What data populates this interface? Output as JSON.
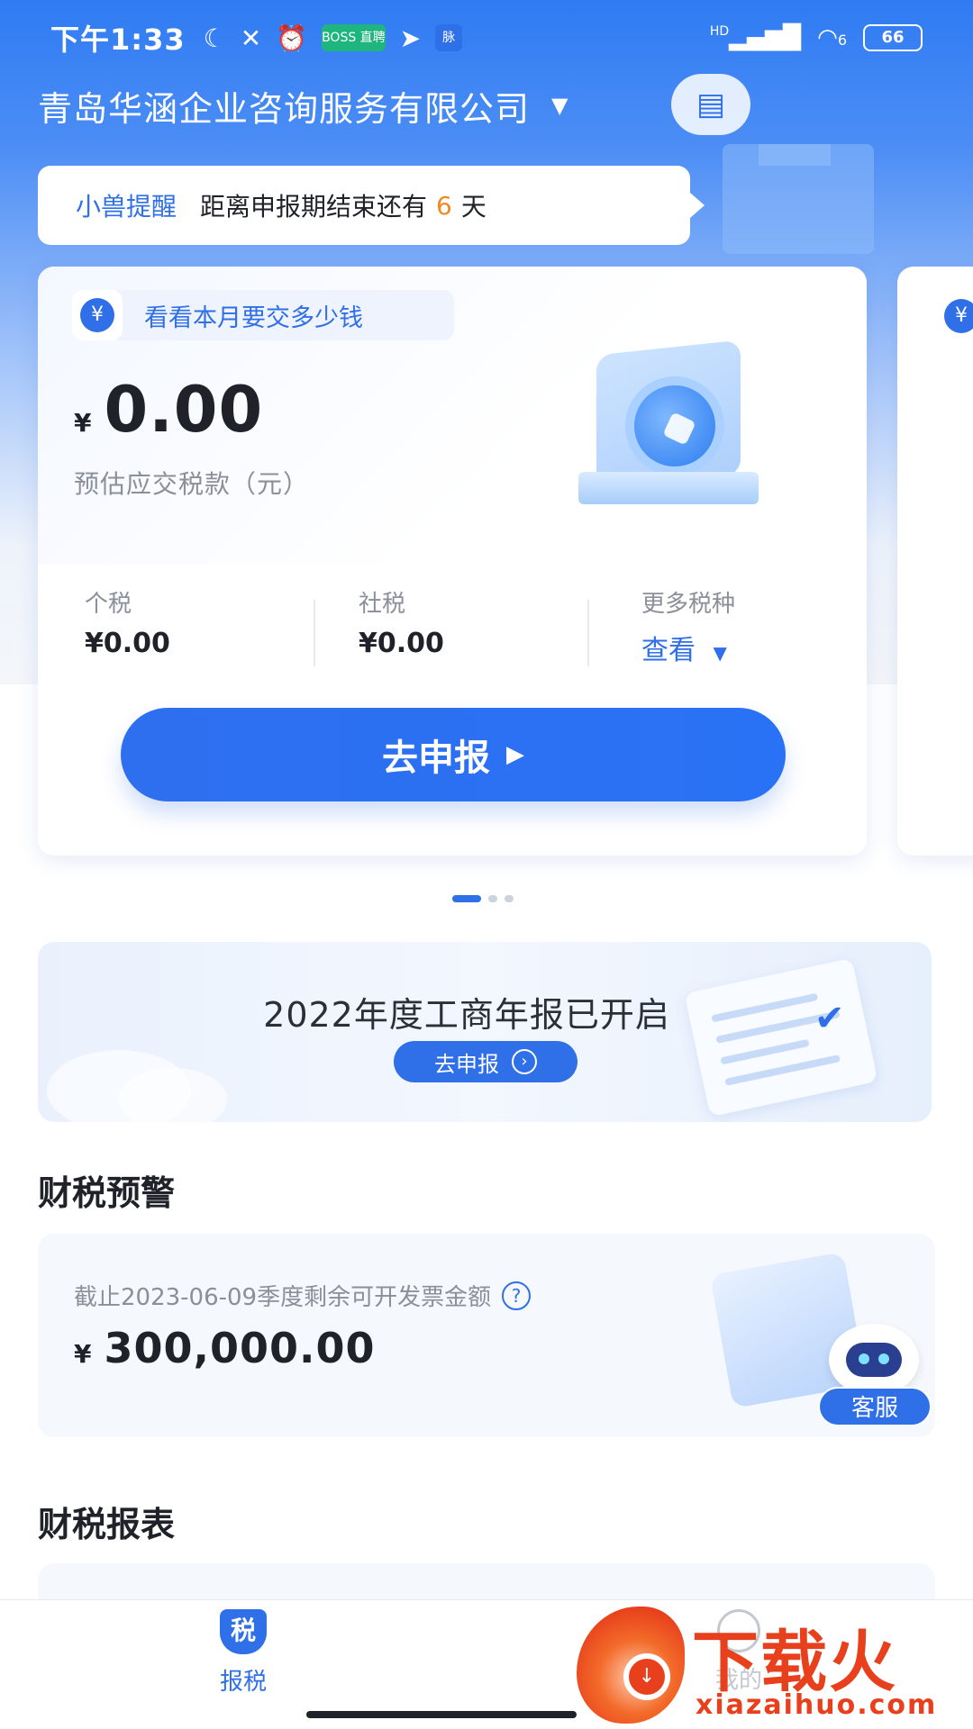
{
  "status_bar": {
    "time": "下午1:33",
    "badges": [
      "BOSS 直聘",
      "脉"
    ],
    "network": "HD",
    "wifi_label": "6",
    "battery": "66"
  },
  "header": {
    "company": "青岛华涵企业咨询服务有限公司"
  },
  "reminder": {
    "title": "小兽提醒",
    "text_before": "距离申报期结束还有",
    "days": "6",
    "text_after": "天"
  },
  "tax_card": {
    "tag": "看看本月要交多少钱",
    "currency": "¥",
    "amount": "0.00",
    "amount_label": "预估应交税款（元）",
    "items": [
      {
        "label": "个税",
        "value": "¥0.00"
      },
      {
        "label": "社税",
        "value": "¥0.00"
      },
      {
        "label": "更多税种",
        "value": "查看"
      }
    ],
    "button": "去申报"
  },
  "carousel": {
    "count": 3,
    "active": 0
  },
  "banner": {
    "title": "2022年度工商年报已开启",
    "button": "去申报"
  },
  "warning": {
    "section_title": "财税预警",
    "label": "截止2023-06-09季度剩余可开发票金额",
    "currency": "¥",
    "amount": "300,000.00",
    "service_label": "客服"
  },
  "report": {
    "section_title": "财税报表"
  },
  "bottom_nav": {
    "tax_icon_char": "税",
    "tax_label": "报税",
    "other_label": "我的"
  },
  "watermark": {
    "brand": "下载火",
    "url": "xiazaihuo.com"
  },
  "colors": {
    "accent": "#2f6fe8",
    "highlight": "#f08a24",
    "watermark": "#e8401c"
  }
}
